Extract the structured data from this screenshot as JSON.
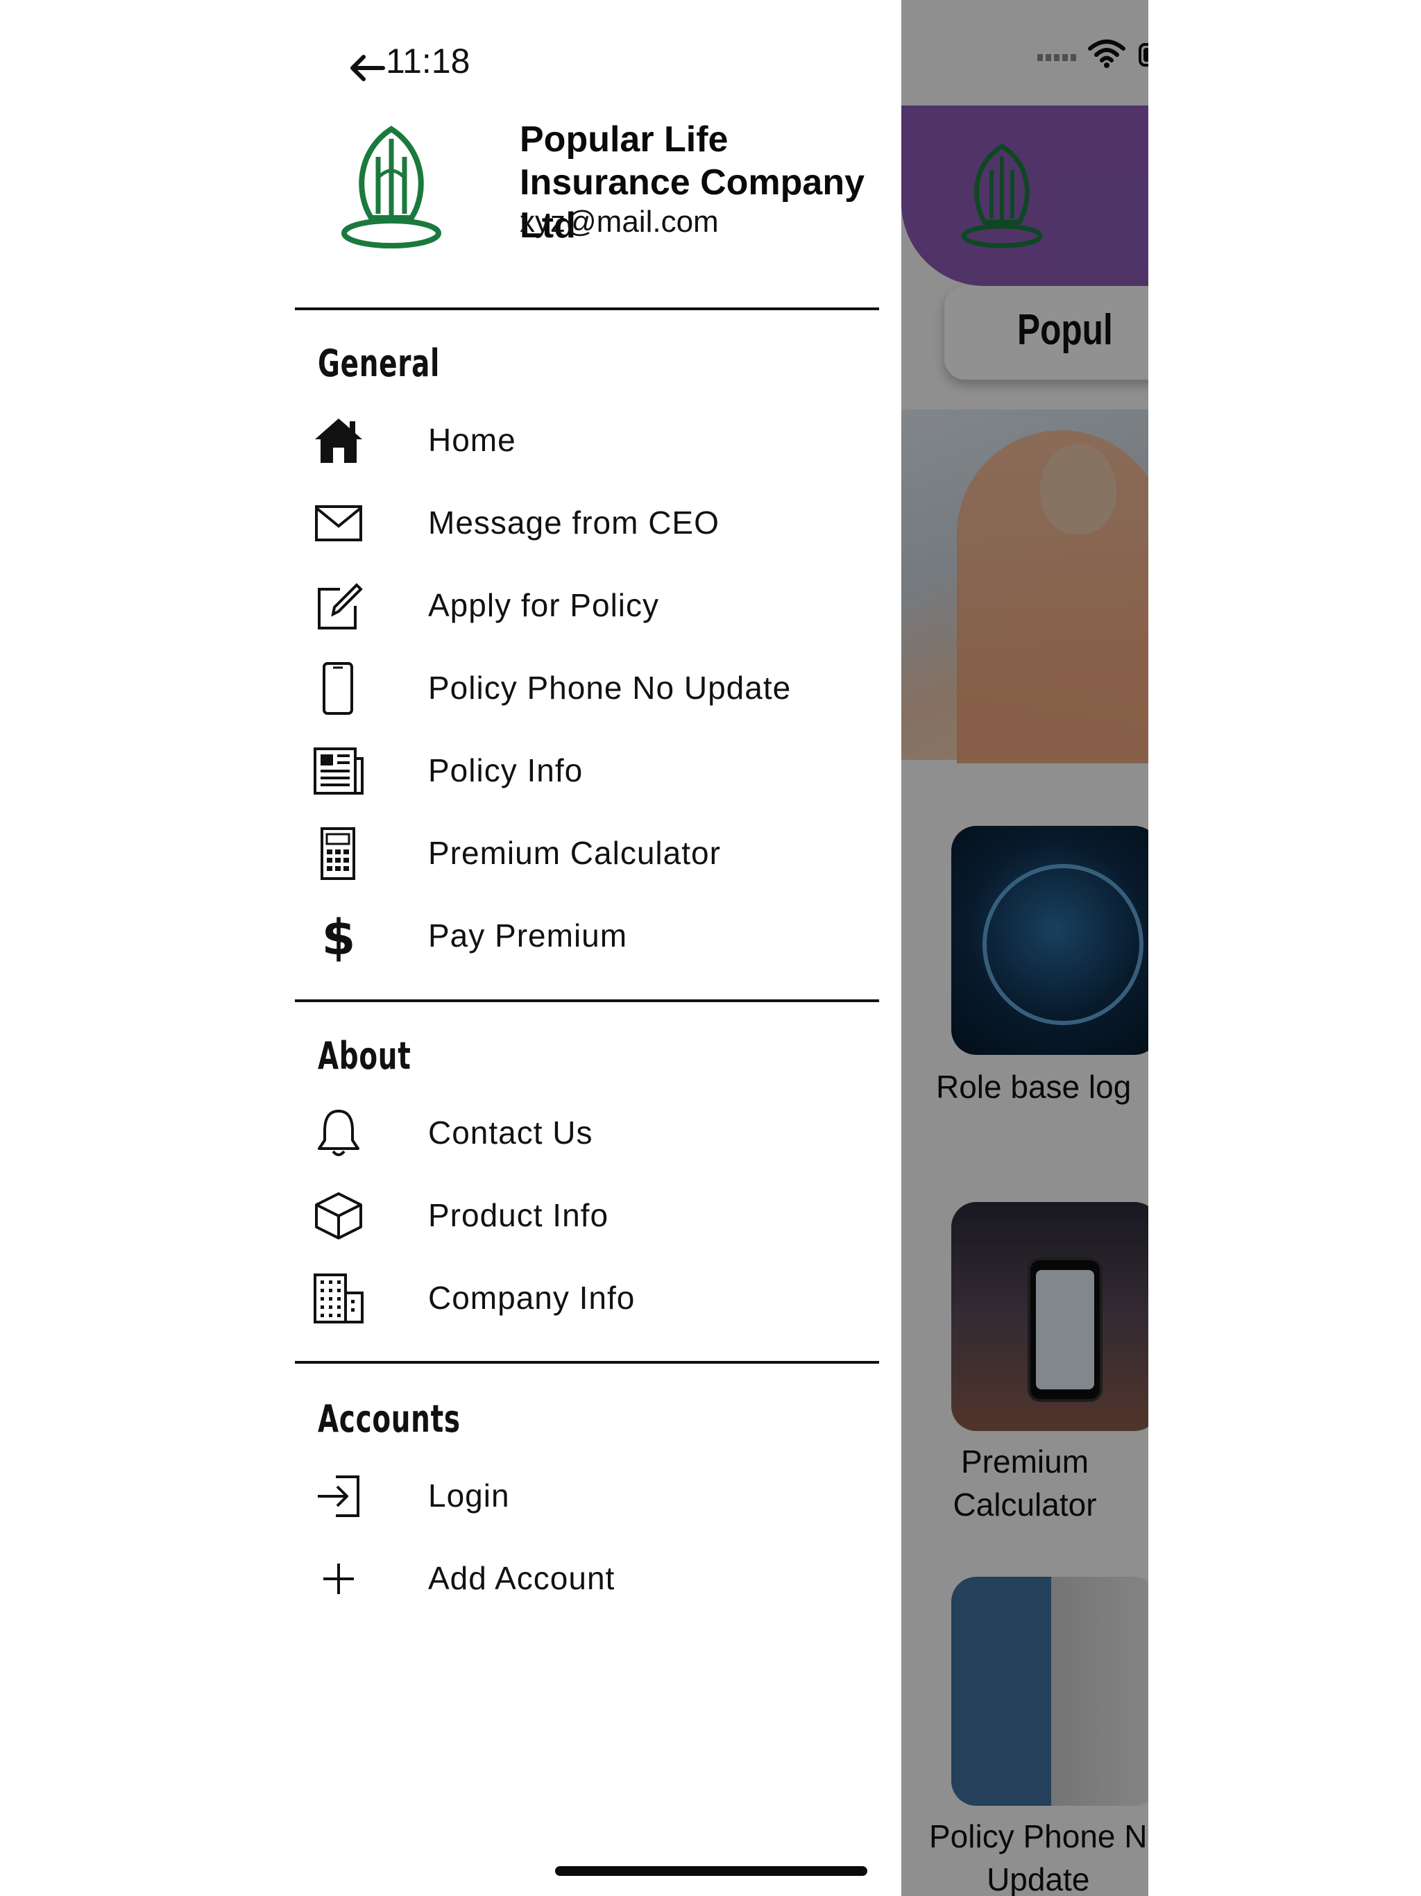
{
  "status": {
    "time": "11:18"
  },
  "drawer": {
    "company_name": "Popular Life Insurance Company Ltd",
    "email": "xyz@mail.com",
    "sections": {
      "general": {
        "title": "General",
        "items": [
          {
            "label": "Home",
            "icon": "home-icon"
          },
          {
            "label": "Message from CEO",
            "icon": "envelope-icon"
          },
          {
            "label": "Apply for Policy",
            "icon": "edit-icon"
          },
          {
            "label": "Policy Phone No Update",
            "icon": "phone-icon"
          },
          {
            "label": "Policy Info",
            "icon": "newspaper-icon"
          },
          {
            "label": "Premium Calculator",
            "icon": "calculator-icon"
          },
          {
            "label": "Pay Premium",
            "icon": "dollar-icon"
          }
        ]
      },
      "about": {
        "title": "About",
        "items": [
          {
            "label": "Contact Us",
            "icon": "bell-icon"
          },
          {
            "label": "Product Info",
            "icon": "box-icon"
          },
          {
            "label": "Company Info",
            "icon": "building-icon"
          }
        ]
      },
      "accounts": {
        "title": "Accounts",
        "items": [
          {
            "label": "Login",
            "icon": "login-icon"
          },
          {
            "label": "Add Account",
            "icon": "plus-icon"
          }
        ]
      }
    }
  },
  "background_app": {
    "header_title": "Popul",
    "tiles": [
      {
        "label": "Role base log"
      },
      {
        "label": "Premium\nCalculator"
      },
      {
        "label": "Policy Phone N\nUpdate"
      }
    ]
  },
  "colors": {
    "header_purple": "#8a5bb3",
    "logo_green": "#1a7a3e",
    "overlay": "rgba(0,0,0,0.42)"
  }
}
